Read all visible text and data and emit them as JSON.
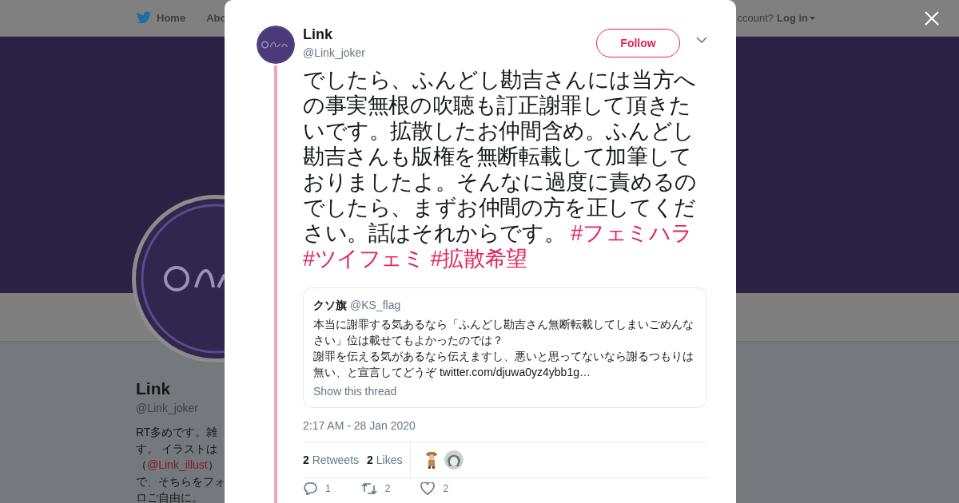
{
  "nav": {
    "items": [
      {
        "label": "Home"
      },
      {
        "label": "Abo"
      }
    ],
    "account_prompt": "ccount?",
    "login": "Log in"
  },
  "profile": {
    "name": "Link",
    "handle": "@Link_joker",
    "bio_lines": [
      {
        "text": "RT多めです。雑"
      },
      {
        "text": "す。 イラストは"
      },
      {
        "before": "（",
        "mention": "@Link_illust",
        "after": "）"
      },
      {
        "text": "で、そちらをフォ"
      },
      {
        "text": "ロご自由に。"
      }
    ]
  },
  "tweet": {
    "author": {
      "name": "Link",
      "handle": "@Link_joker"
    },
    "follow_label": "Follow",
    "text": "でしたら、ふんどし勘吉さんには当方への事実無根の吹聴も訂正謝罪して頂きたいです。拡散したお仲間含め。ふんどし勘吉さんも版権を無断転載して加筆しておりましたよ。そんなに過度に責めるのでしたら、まずお仲間の方を正してください。話はそれからです。",
    "hashtags": [
      "#フェミハラ",
      "#ツイフェミ",
      "#拡散希望"
    ],
    "quote": {
      "name": "クソ旗",
      "handle": "@KS_flag",
      "lines": [
        "本当に謝罪する気あるなら「ふんどし勘吉さん無断転載してしまいごめんなさい」位は載せてもよかったのでは？",
        "謝罪を伝える気があるなら伝えますし、悪いと思ってないなら謝るつもりは無い、と宣言してどうぞ"
      ],
      "link": "twitter.com/djuwa0yz4ybb1g…",
      "thread_link": "Show this thread"
    },
    "timestamp": "2:17 AM - 28 Jan 2020",
    "stats": [
      {
        "count": "2",
        "label": "Retweets"
      },
      {
        "count": "2",
        "label": "Likes"
      }
    ],
    "actions": [
      {
        "kind": "reply",
        "count": "1"
      },
      {
        "kind": "retweet",
        "count": "2"
      },
      {
        "kind": "like",
        "count": "2"
      }
    ]
  }
}
